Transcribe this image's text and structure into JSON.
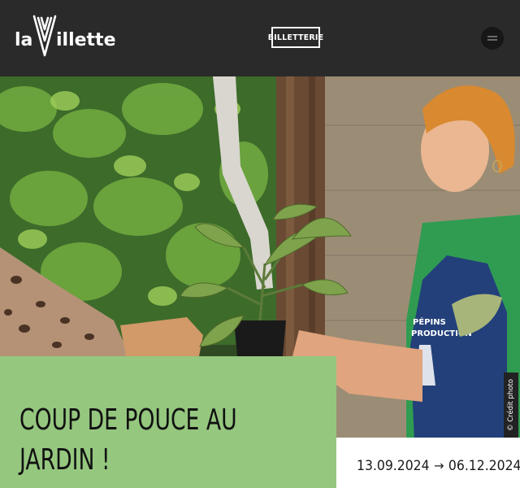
{
  "header": {
    "logo_text": "laVillette",
    "ticket_button_label": "BILLETTERIE",
    "menu_icon": "hamburger-icon"
  },
  "hero": {
    "image_alt": "Person holding a potted plant wearing an apron printed PÉPINS PRODUCTION",
    "apron_text_line1": "PÉPINS",
    "apron_text_line2": "PRODUCTION",
    "photo_credit": "© Crédit photo"
  },
  "event": {
    "title_line1": "COUP DE POUCE AU",
    "title_line2": "JARDIN !",
    "start_date": "13.09.2024",
    "end_date": "06.12.2024"
  },
  "colors": {
    "header_bg": "#2a2a2a",
    "title_block_bg": "#95c77f"
  }
}
